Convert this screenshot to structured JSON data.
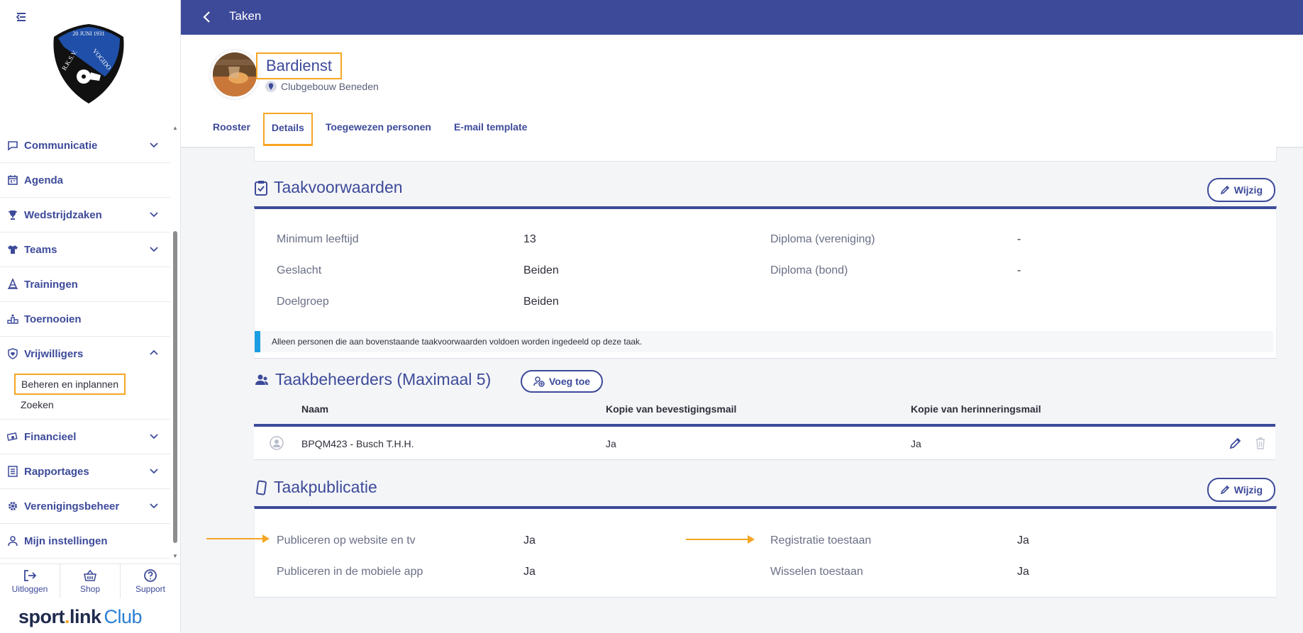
{
  "club_logo_text": {
    "top": "20 JUNI 1931",
    "left": "R.K.S.V.",
    "right": "VOGIDO"
  },
  "sidebar": {
    "items": [
      {
        "label": "Communicatie",
        "icon": "chat-icon",
        "chevron": true
      },
      {
        "label": "Agenda",
        "icon": "calendar-icon",
        "chevron": false
      },
      {
        "label": "Wedstrijdzaken",
        "icon": "trophy-icon",
        "chevron": true
      },
      {
        "label": "Teams",
        "icon": "shirt-icon",
        "chevron": true
      },
      {
        "label": "Trainingen",
        "icon": "cone-icon",
        "chevron": false
      },
      {
        "label": "Toernooien",
        "icon": "podium-icon",
        "chevron": false
      },
      {
        "label": "Vrijwilligers",
        "icon": "heart-shield-icon",
        "chevron": true,
        "open": true
      },
      {
        "label": "Financieel",
        "icon": "money-icon",
        "chevron": true
      },
      {
        "label": "Rapportages",
        "icon": "report-icon",
        "chevron": true
      },
      {
        "label": "Verenigingsbeheer",
        "icon": "gear-icon",
        "chevron": true
      },
      {
        "label": "Mijn instellingen",
        "icon": "user-icon",
        "chevron": false
      }
    ],
    "subitems": [
      {
        "label": "Beheren en inplannen",
        "active": true
      },
      {
        "label": "Zoeken",
        "active": false
      }
    ],
    "bottom": [
      {
        "label": "Uitloggen",
        "icon": "logout-icon"
      },
      {
        "label": "Shop",
        "icon": "basket-icon"
      },
      {
        "label": "Support",
        "icon": "help-icon"
      }
    ],
    "brand": {
      "part1": "sport",
      "dot": ".",
      "part2": "link",
      "part3": "Club"
    }
  },
  "topbar": {
    "title": "Taken"
  },
  "header": {
    "title": "Bardienst",
    "location": "Clubgebouw Beneden",
    "tabs": [
      {
        "label": "Rooster",
        "active": false
      },
      {
        "label": "Details",
        "active": true
      },
      {
        "label": "Toegewezen personen",
        "active": false
      },
      {
        "label": "E-mail template",
        "active": false
      }
    ]
  },
  "taakvoorwaarden": {
    "title": "Taakvoorwaarden",
    "edit_label": "Wijzig",
    "fields": {
      "min_age_label": "Minimum leeftijd",
      "min_age_value": "13",
      "gender_label": "Geslacht",
      "gender_value": "Beiden",
      "target_label": "Doelgroep",
      "target_value": "Beiden",
      "diploma_club_label": "Diploma (vereniging)",
      "diploma_club_value": "-",
      "diploma_bond_label": "Diploma (bond)",
      "diploma_bond_value": "-"
    },
    "notice": "Alleen personen die aan bovenstaande taakvoorwaarden voldoen worden ingedeeld op deze taak."
  },
  "taakbeheerders": {
    "title": "Taakbeheerders (Maximaal 5)",
    "add_label": "Voeg toe",
    "columns": [
      "Naam",
      "Kopie van bevestigingsmail",
      "Kopie van herinneringsmail"
    ],
    "rows": [
      {
        "name": "BPQM423 - Busch T.H.H.",
        "confirm": "Ja",
        "reminder": "Ja"
      }
    ]
  },
  "taakpublicatie": {
    "title": "Taakpublicatie",
    "edit_label": "Wijzig",
    "fields": {
      "website_label": "Publiceren op website en tv",
      "website_value": "Ja",
      "app_label": "Publiceren in de mobiele app",
      "app_value": "Ja",
      "registration_label": "Registratie toestaan",
      "registration_value": "Ja",
      "swap_label": "Wisselen toestaan",
      "swap_value": "Ja"
    }
  },
  "colors": {
    "primary": "#3d4a9a",
    "highlight": "#f5a623",
    "info": "#1a9ee2"
  }
}
